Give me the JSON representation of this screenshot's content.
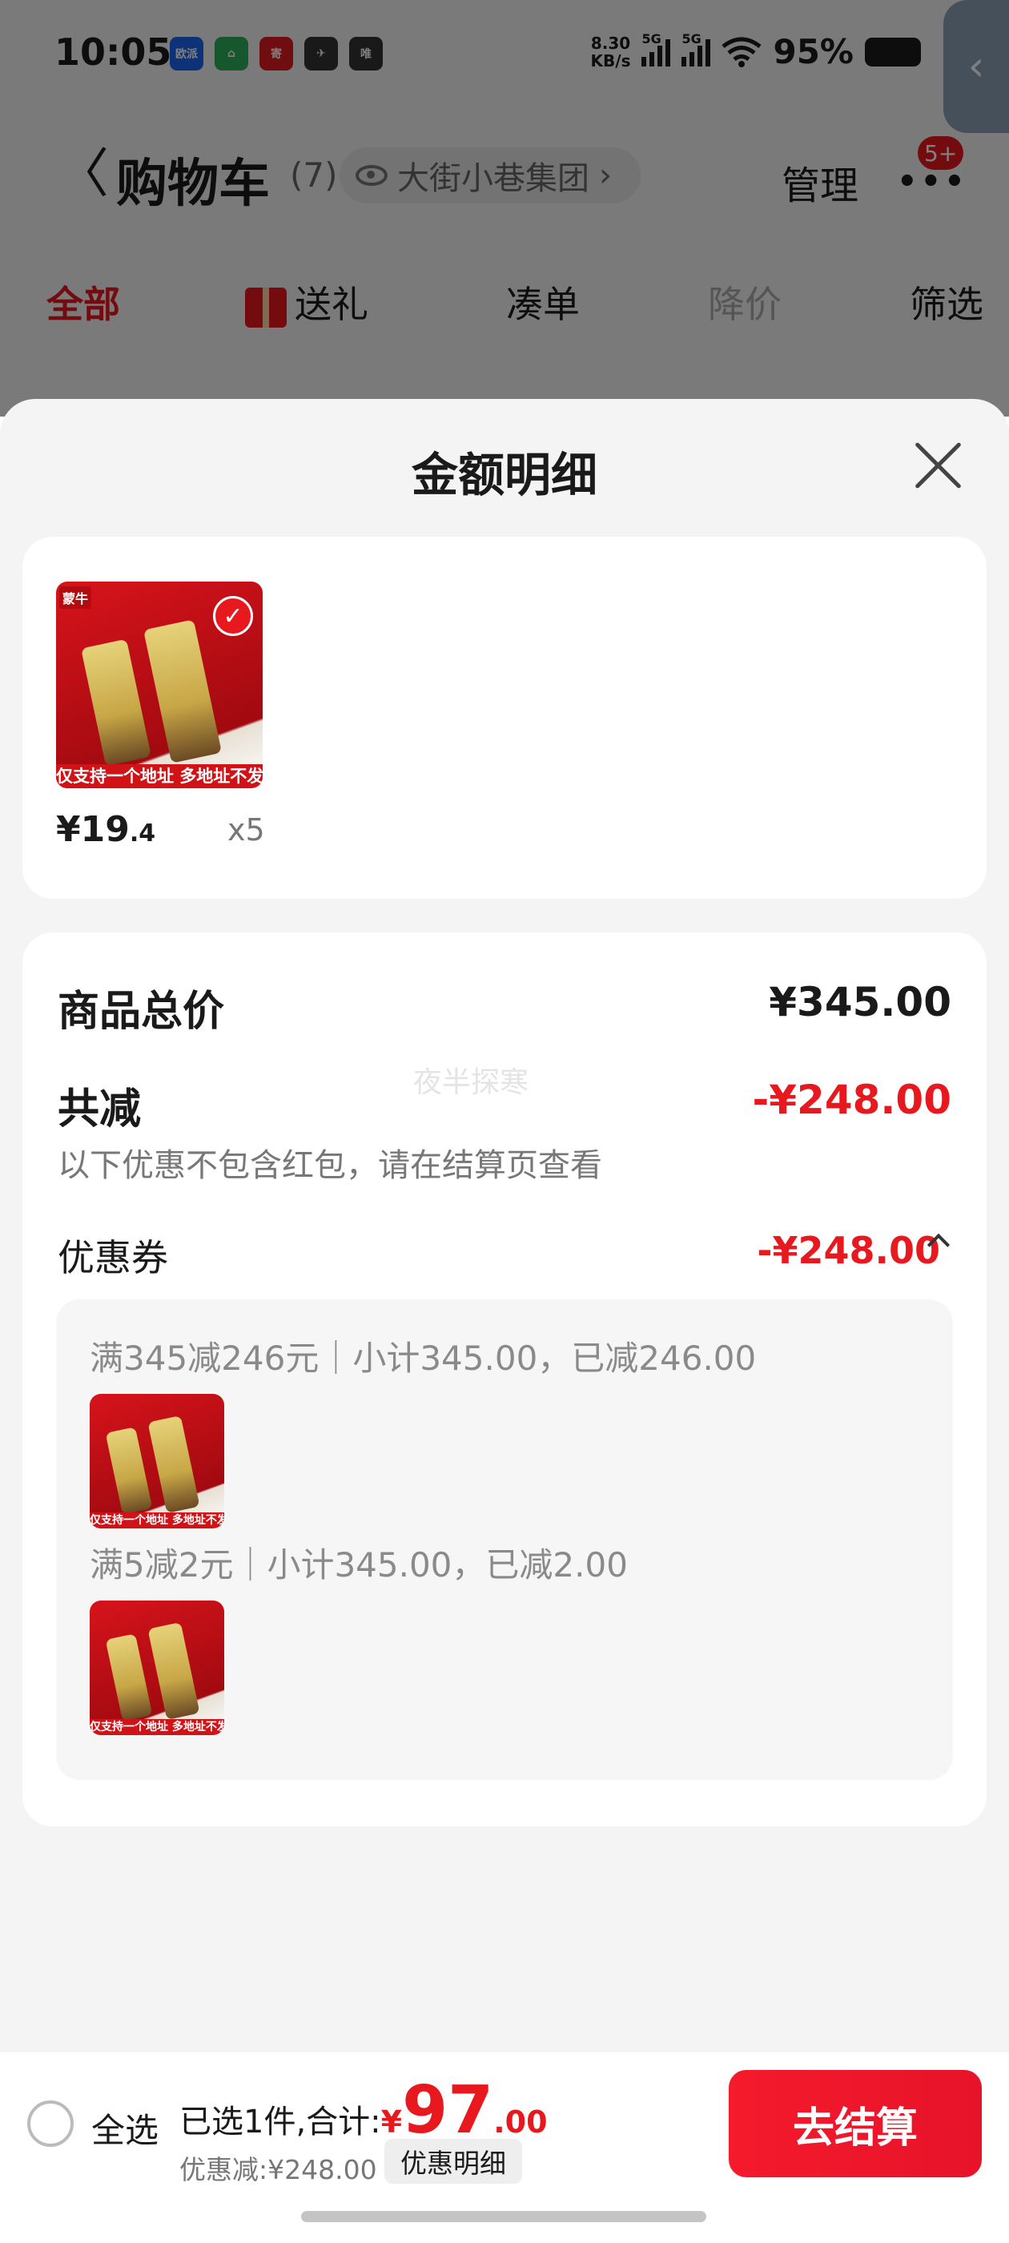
{
  "status_bar": {
    "time": "10:05",
    "net_speed_value": "8.30",
    "net_speed_unit": "KB/s",
    "signal1_label": "5G",
    "signal2_label": "5G",
    "battery": "95%",
    "apps": [
      {
        "icon": "oupai-app-icon",
        "label": "欧派",
        "color": "#1b64f0"
      },
      {
        "icon": "home-app-icon",
        "label": "⌂",
        "color": "#2fae5a"
      },
      {
        "icon": "red-app-icon",
        "label": "寄",
        "color": "#e01b22"
      },
      {
        "icon": "bird-app-icon",
        "label": "✈",
        "color": "#333333"
      },
      {
        "icon": "vip-app-icon",
        "label": "唯",
        "color": "#333333"
      }
    ]
  },
  "cart_header": {
    "title": "购物车",
    "count": "(7)",
    "shop_name": "大街小巷集团",
    "shop_chevron": "›",
    "manage": "管理",
    "more": "•••",
    "badge": "5+"
  },
  "filter_tabs": {
    "all": "全部",
    "gift": "送礼",
    "combine": "凑单",
    "price_drop": "降价",
    "filter": "筛选"
  },
  "sheet": {
    "title": "金额明细",
    "item": {
      "brand_tag": "蒙牛",
      "notice": "仅支持一个地址 多地址不发货",
      "price_int": "¥19",
      "price_dec": ".4",
      "qty": "x5"
    },
    "summary": {
      "total_label": "商品总价",
      "total_value": "¥345.00",
      "reduce_label": "共减",
      "reduce_value": "-¥248.00",
      "note": "以下优惠不包含红包，请在结算页查看",
      "watermark": "夜半探寒",
      "coupon_label": "优惠券",
      "coupon_value": "-¥248.00",
      "coupons": [
        {
          "rule": "满345减246元｜小计345.00，已减246.00"
        },
        {
          "rule": "满5减2元｜小计345.00，已减2.00"
        }
      ]
    }
  },
  "bottom_bar": {
    "select_all": "全选",
    "selected_text": "已选1件,合计:",
    "currency": "¥",
    "total_int": "97",
    "total_dec": ".00",
    "discount": "优惠减:¥248.00",
    "detail_button": "优惠明细",
    "checkout": "去结算"
  },
  "colors": {
    "accent": "#e8191e",
    "sheet_bg": "#f4f4f4"
  }
}
